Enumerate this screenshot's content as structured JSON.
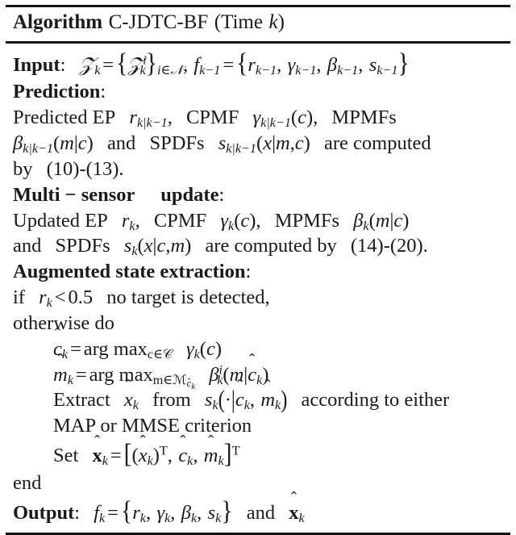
{
  "document": {
    "type": "algorithm-pseudocode-block",
    "title": {
      "keyword": "Algorithm",
      "name": "C-JDTC-BF",
      "paren_open": "(",
      "time_word": "Time",
      "time_var": "k",
      "paren_close": ")"
    },
    "sections": [
      {
        "heading": "Input",
        "colon": ":"
      },
      {
        "heading": "Prediction",
        "colon": ":"
      },
      {
        "heading": "Multi − sensor",
        "heading2": "update",
        "colon": ":"
      },
      {
        "heading": "Augmented state extraction",
        "colon": ":"
      },
      {
        "heading": "Output",
        "colon": ":"
      }
    ],
    "lines": {
      "input_text": "Input:  𝒵_k = {𝒵_k^i}_{i∈N}, f_{k-1} = {r_{k-1}, γ_{k-1}, β_{k-1}, s_{k-1}}",
      "prediction_heading": "Prediction:",
      "prediction_l1": "Predicted EP r_{k|k-1}, CPMF γ_{k|k-1}(c), MPMFs",
      "prediction_l2": "β_{k|k-1}(m|c) and SPDFs s_{k|k-1}(x|m,c) are computed",
      "prediction_l3": "by (10)-(13).",
      "update_heading": "Multi − sensor   update:",
      "update_l1": "Updated EP r_k, CPMF γ_k(c), MPMFs β_k(m|c)",
      "update_l2": "and SPDFs s_k(x|c,m) are computed by (14)-(20).",
      "extraction_heading": "Augmented state extraction:",
      "extraction_l1": "if r_k < 0.5 no target is detected,",
      "extraction_l2": "otherwise do",
      "extraction_l3": "ĉ_k = arg max_{c∈C} γ_k(c)",
      "extraction_l4": "m̂_k = arg max_{m∈M_{ĉ_k}} β_k^i(m|ĉ_k)",
      "extraction_l5": "Extract x̂_k from s_k(·|ĉ_k, m̂_k) according to either",
      "extraction_l6": "MAP or MMSE criterion",
      "extraction_l7": "Set x̂_k = [(x̂_k)^T, ĉ_k, m̂_k]^T",
      "end": "end",
      "output_text": "Output:  f_k = {r_k, γ_k, β_k, s_k} and x̂_k"
    },
    "tokens": {
      "input_kw": "Input",
      "prediction_kw": "Prediction",
      "multi_sensor_kw": "Multi − sensor",
      "update_kw": "update",
      "augmented_kw": "Augmented state extraction",
      "output_kw": "Output",
      "colon": ":",
      "predicted_ep": "Predicted EP",
      "updated_ep": "Updated EP",
      "cpmf": "CPMF",
      "mpmfs": "MPMFs",
      "spdfs": "SPDFs",
      "and": "and",
      "are_computed": "are computed",
      "by": "by",
      "computed_by": "are computed by",
      "ref_10_13": "(10)-(13).",
      "ref_14_20": "(14)-(20).",
      "if": "if",
      "lt": "<",
      "threshold": "0.5",
      "no_target": "no target is detected,",
      "otherwise_do": "otherwise do",
      "argmax": "arg max",
      "extract": "Extract",
      "from": "from",
      "according": "according to either",
      "map_mmse": "MAP or MMSE criterion",
      "set": "Set",
      "end": "end",
      "and2": "and"
    },
    "colors": {
      "text": "#1a1a1a",
      "rule": "#111111",
      "background": "#ffffff"
    }
  }
}
